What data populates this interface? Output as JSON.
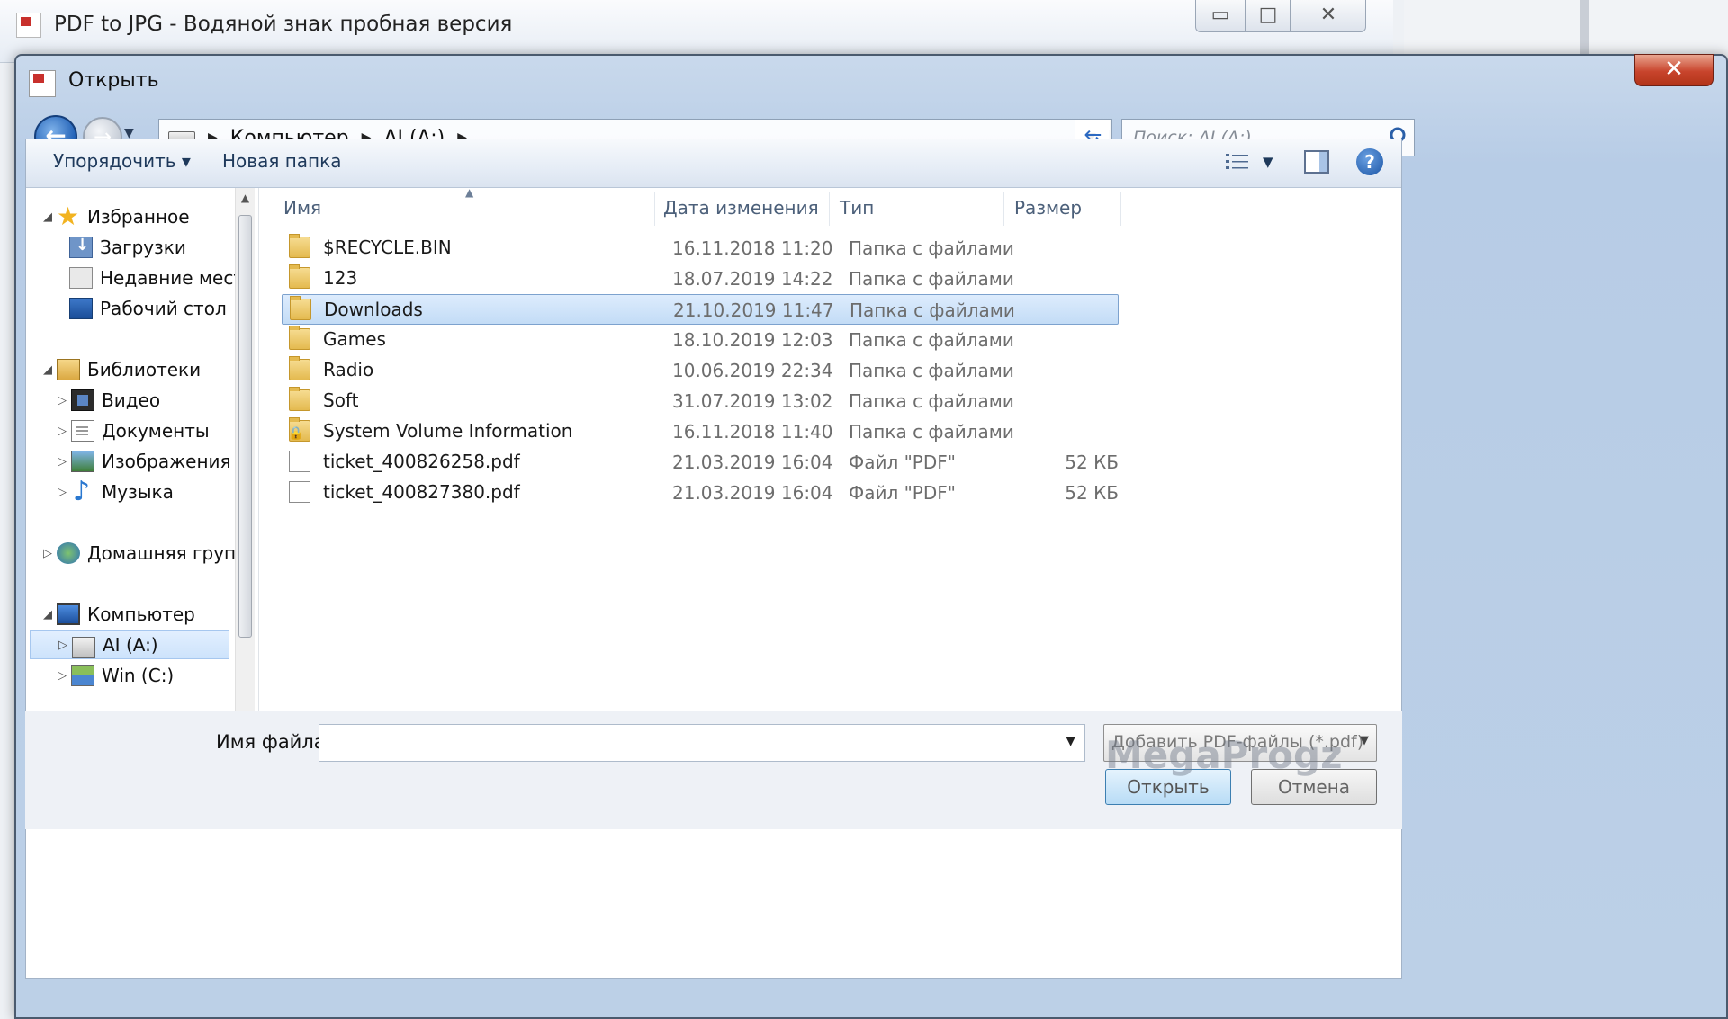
{
  "background_app": {
    "title": "PDF to JPG - Водяной знак пробная версия",
    "controls": [
      "▭",
      "□",
      "✕"
    ]
  },
  "dialog": {
    "title": "Открыть",
    "close": "✕"
  },
  "address": {
    "crumbs": [
      "Компьютер",
      "AI (A:)"
    ],
    "search_placeholder": "Поиск: AI (A:)"
  },
  "toolbar": {
    "organize": "Упорядочить ▾",
    "new_folder": "Новая папка",
    "help": "?"
  },
  "nav": {
    "favorites": "Избранное",
    "downloads": "Загрузки",
    "recent": "Недавние места",
    "desktop": "Рабочий стол",
    "libraries": "Библиотеки",
    "video": "Видео",
    "documents": "Документы",
    "images": "Изображения",
    "music": "Музыка",
    "homegroup": "Домашняя группа",
    "computer": "Компьютер",
    "drive_a": "AI (A:)",
    "drive_c": "Win (C:)"
  },
  "columns": {
    "name": "Имя",
    "date": "Дата изменения",
    "type": "Тип",
    "size": "Размер"
  },
  "files": [
    {
      "name": "$RECYCLE.BIN",
      "date": "16.11.2018 11:20",
      "type": "Папка с файлами",
      "size": ""
    },
    {
      "name": "123",
      "date": "18.07.2019 14:22",
      "type": "Папка с файлами",
      "size": ""
    },
    {
      "name": "Downloads",
      "date": "21.10.2019 11:47",
      "type": "Папка с файлами",
      "size": ""
    },
    {
      "name": "Games",
      "date": "18.10.2019 12:03",
      "type": "Папка с файлами",
      "size": ""
    },
    {
      "name": "Radio",
      "date": "10.06.2019 22:34",
      "type": "Папка с файлами",
      "size": ""
    },
    {
      "name": "Soft",
      "date": "31.07.2019 13:02",
      "type": "Папка с файлами",
      "size": ""
    },
    {
      "name": "System Volume Information",
      "date": "16.11.2018 11:40",
      "type": "Папка с файлами",
      "size": ""
    },
    {
      "name": "ticket_400826258.pdf",
      "date": "21.03.2019 16:04",
      "type": "Файл \"PDF\"",
      "size": "52 КБ"
    },
    {
      "name": "ticket_400827380.pdf",
      "date": "21.03.2019 16:04",
      "type": "Файл \"PDF\"",
      "size": "52 КБ"
    }
  ],
  "bottom": {
    "filename_label": "Имя файла:",
    "filename_value": "",
    "filetype": "Добавить PDF-файлы (*.pdf)",
    "open": "Открыть",
    "cancel": "Отмена",
    "watermark": "MegaProgz"
  }
}
